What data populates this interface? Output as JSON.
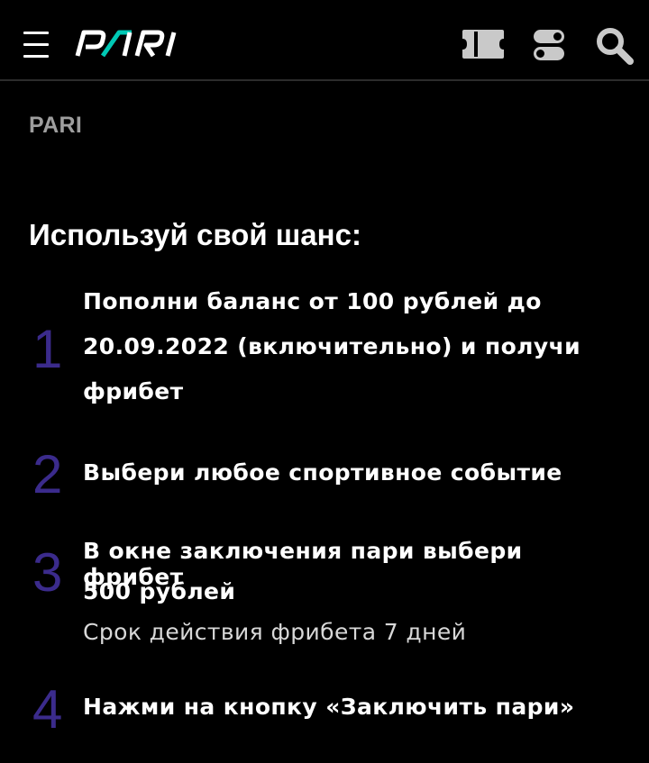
{
  "header": {
    "logo_text": "PARI",
    "brand_accent": "#00c8b4",
    "icons": [
      "menu-icon",
      "coupon-icon",
      "toggles-icon",
      "search-icon"
    ]
  },
  "breadcrumb": "PARI",
  "title": "Используй свой шанс:",
  "steps": [
    {
      "number": "1",
      "line1": "Пополни баланс от 100 рублей до",
      "line2": "20.09.2022 (включительно) и получи",
      "line3": "фрибет"
    },
    {
      "number": "2",
      "line1": "Выбери любое спортивное событие"
    },
    {
      "number": "3",
      "line1": "В окне заключения пари выбери фрибет",
      "line2": "500 рублей",
      "note": "Срок действия фрибета 7 дней"
    },
    {
      "number": "4",
      "line1": "Нажми на кнопку «Заключить пари»"
    }
  ],
  "colors": {
    "background": "#000000",
    "step_number": "#3b2b8c",
    "muted_text": "#9e9e9e"
  }
}
